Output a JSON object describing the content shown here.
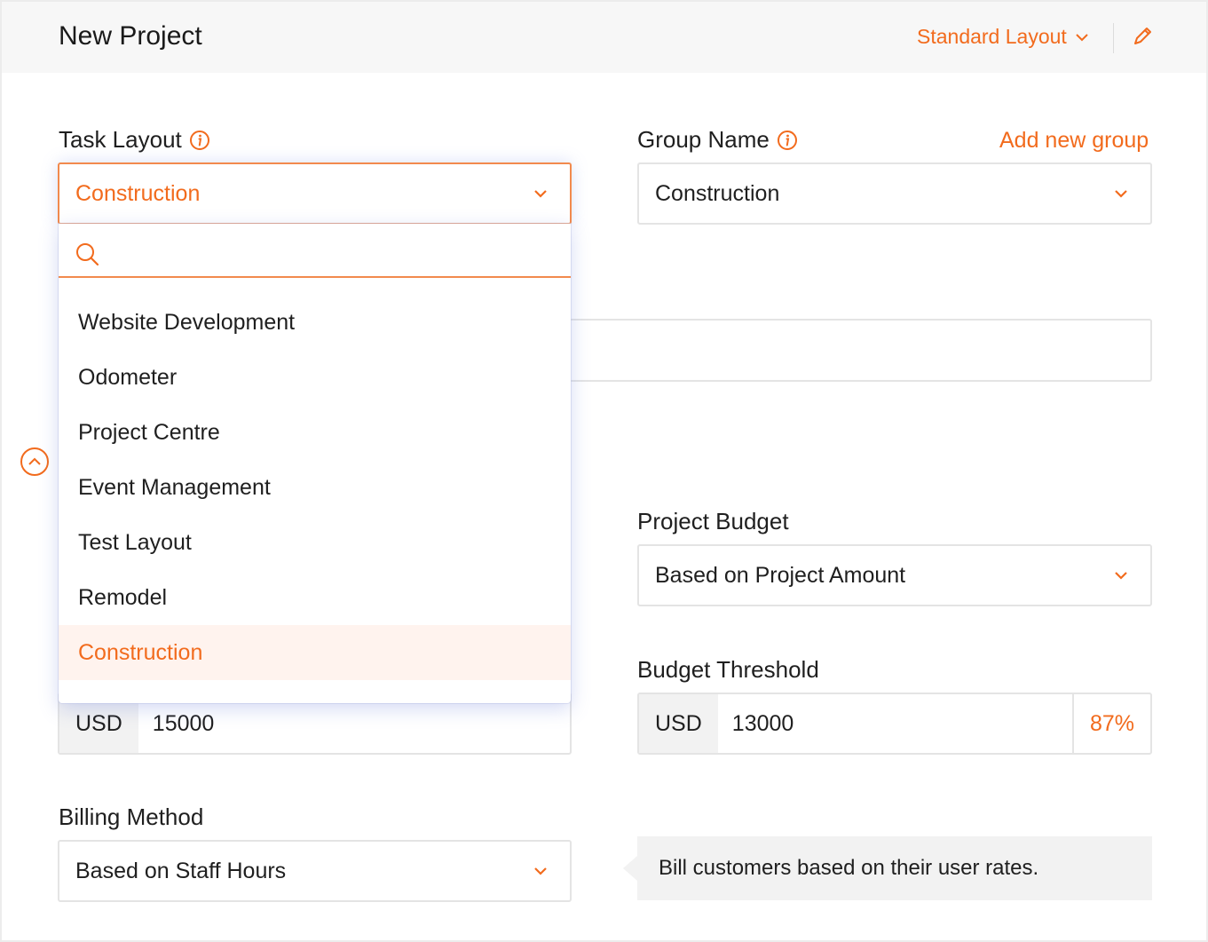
{
  "header": {
    "title": "New Project",
    "layout_switch": "Standard Layout"
  },
  "task_layout": {
    "label": "Task Layout",
    "value": "Construction",
    "search_placeholder": "",
    "options": [
      {
        "label": "Website Development",
        "selected": false
      },
      {
        "label": "Odometer",
        "selected": false
      },
      {
        "label": "Project Centre",
        "selected": false
      },
      {
        "label": "Event Management",
        "selected": false
      },
      {
        "label": "Test Layout",
        "selected": false
      },
      {
        "label": "Remodel",
        "selected": false
      },
      {
        "label": "Construction",
        "selected": true
      }
    ]
  },
  "group_name": {
    "label": "Group Name",
    "add_link": "Add new group",
    "value": "Construction"
  },
  "project_budget": {
    "label": "Project Budget",
    "value": "Based on Project Amount"
  },
  "project_amount": {
    "currency": "USD",
    "value": "15000"
  },
  "budget_threshold": {
    "label": "Budget Threshold",
    "currency": "USD",
    "value": "13000",
    "percent": "87%"
  },
  "billing_method": {
    "label": "Billing Method",
    "value": "Based on Staff Hours",
    "hint": "Bill customers based on their user rates."
  },
  "colors": {
    "accent": "#f26b1d",
    "selected_bg": "#fff3ee",
    "header_bg": "#f7f7f7"
  },
  "icons": [
    "chevron-down-icon",
    "pencil-icon",
    "info-icon",
    "search-icon",
    "chevron-up-circle-icon"
  ]
}
